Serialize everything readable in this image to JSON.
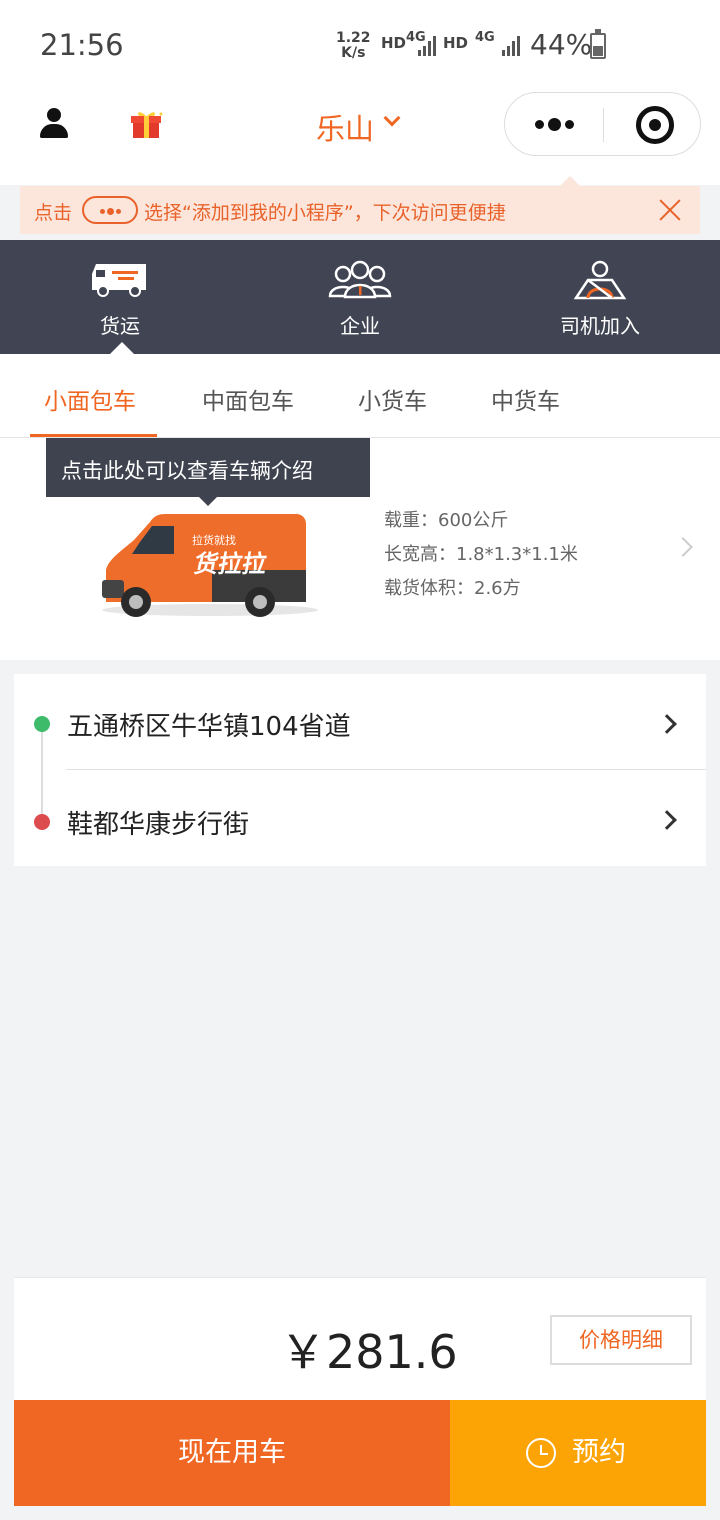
{
  "status_bar": {
    "time": "21:56",
    "net_speed_value": "1.22",
    "net_speed_unit": "K/s",
    "sig1": "HD",
    "sig2": "4G",
    "sig3": "HD",
    "sig4": "4G",
    "battery": "44%"
  },
  "header": {
    "city": "乐山",
    "icons": [
      "user-icon",
      "gift-icon",
      "more-dots-icon",
      "target-icon"
    ]
  },
  "tip": {
    "prefix": "点击",
    "text": "选择“添加到我的小程序”，下次访问更便捷"
  },
  "nav": {
    "items": [
      {
        "label": "货运",
        "icon": "truck-icon"
      },
      {
        "label": "企业",
        "icon": "people-icon"
      },
      {
        "label": "司机加入",
        "icon": "driver-icon"
      }
    ]
  },
  "vehicle_tabs": [
    "小面包车",
    "中面包车",
    "小货车",
    "中货车"
  ],
  "vehicle": {
    "tooltip": "点击此处可以查看车辆介绍",
    "brand_small": "拉货就找",
    "brand_big": "货拉拉",
    "load": "载重：600公斤",
    "size": "长宽高：1.8*1.3*1.1米",
    "volume": "载货体积：2.6方"
  },
  "route": {
    "from": "五通桥区牛华镇104省道",
    "to": "鞋都华康步行街"
  },
  "bottom": {
    "price": "￥281.6",
    "detail_label": "价格明细",
    "now_label": "现在用车",
    "book_label": "预约"
  },
  "colors": {
    "accent": "#f06724",
    "book": "#fca406",
    "nav_bg": "#414453",
    "tip_bg": "#fce6dc"
  }
}
